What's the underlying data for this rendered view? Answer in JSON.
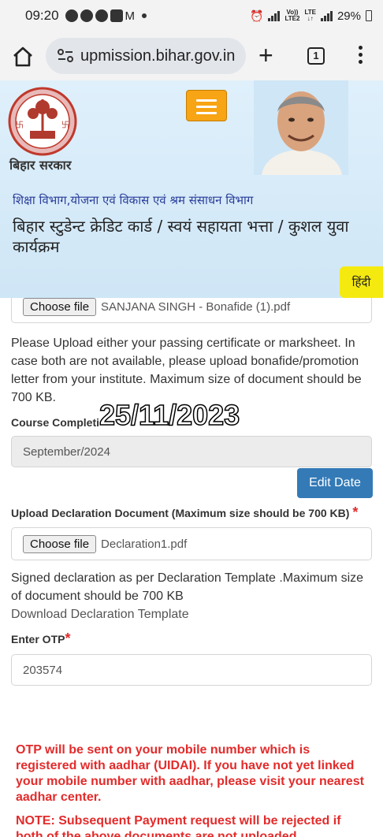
{
  "status": {
    "time": "09:20",
    "battery": "29%",
    "volte": "Vo))",
    "lte": "LTE",
    "lte2": "LTE2"
  },
  "browser": {
    "url": "upmission.bihar.gov.in",
    "tab_count": "1"
  },
  "header": {
    "gov_name": "बिहार सरकार",
    "department": "शिक्षा विभाग,योजना एवं विकास एवं श्रम संसाधन विभाग",
    "scheme_title": "बिहार स्टुडेन्ट क्रेडिट कार्ड / स्वयं सहायता भत्ता / कुशल युवा कार्यक्रम",
    "language_button": "हिंदी",
    "accent_color": "#f7a415"
  },
  "form": {
    "choose_file_label": "Choose file",
    "bonafide_file": "SANJANA SINGH - Bonafide (1).pdf",
    "bonafide_help": "Please Upload either your passing certificate or marksheet. In case both are not available, please upload bonafide/promotion letter from your institute. Maximum size of document should be 700 KB.",
    "course_completion_label": "Course Completi",
    "course_completion_value": "September/2024",
    "date_overlay": "25/11/2023",
    "edit_date_button": "Edit Date",
    "declaration_label": "Upload Declaration Document (Maximum size should be 700 KB)",
    "required_mark": "*",
    "declaration_file": "Declaration1.pdf",
    "declaration_help": "Signed declaration as per Declaration Template .Maximum size of document should be 700 KB",
    "download_template": "Download Declaration Template",
    "otp_label": "Enter OTP",
    "otp_value": "203574",
    "otp_warning": "OTP will be sent on your mobile number which is registered with aadhar (UIDAI). If you have not yet linked your mobile number with aadhar, please visit your nearest aadhar center.",
    "note_warning": "NOTE: Subsequent Payment request will be rejected if both of the above documents are not uploaded"
  }
}
